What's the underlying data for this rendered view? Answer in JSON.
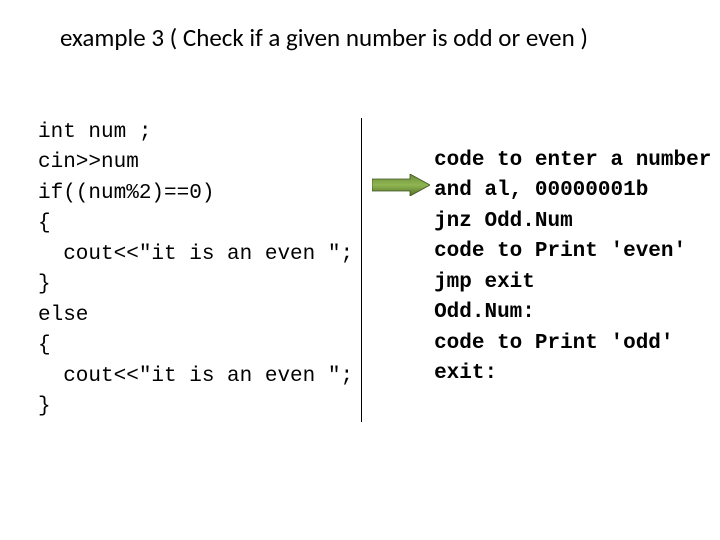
{
  "title": "example 3 ( Check if a given number is odd or even )",
  "left_code": "int num ;\ncin>>num\nif((num%2)==0)\n{\n  cout<<\"it is an even \";\n}\nelse\n{\n  cout<<\"it is an even \";\n}",
  "right_code": "code to enter a number\nand al, 00000001b\njnz Odd.Num\ncode to Print 'even'\njmp exit\nOdd.Num:\ncode to Print 'odd'\nexit:"
}
